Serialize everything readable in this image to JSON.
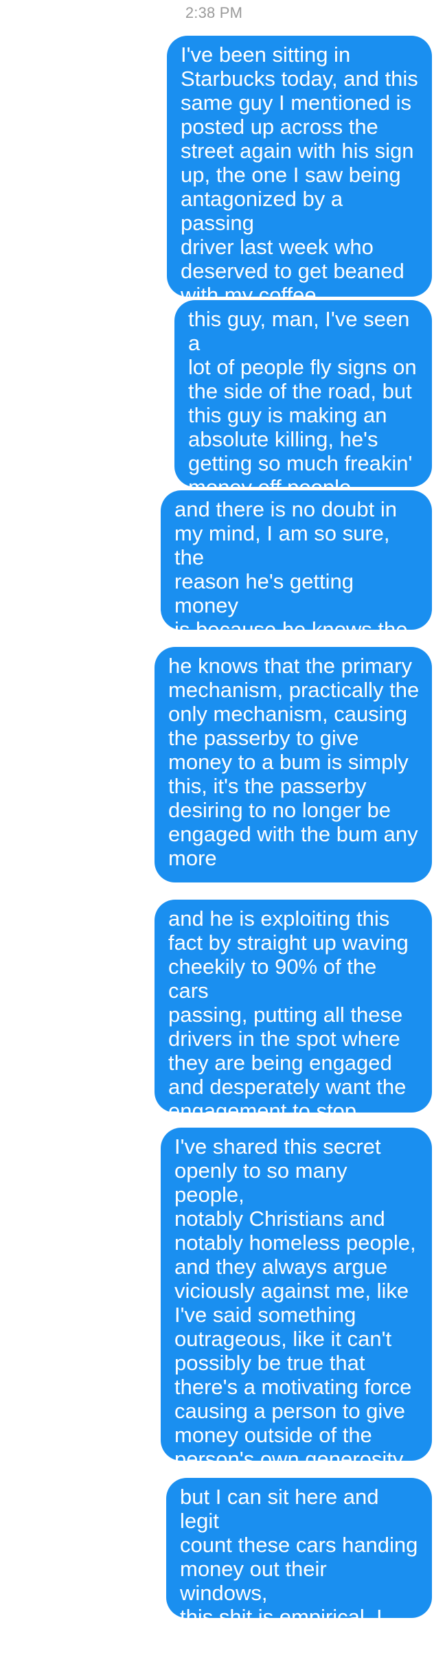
{
  "conversation": {
    "timestamp": "2:38 PM",
    "messages": [
      {
        "sender": "me",
        "text": "I've been sitting in\nStarbucks today, and this\nsame guy I mentioned is\nposted up across the\nstreet again with his sign\nup, the one I saw being\nantagonized by a passing\ndriver last week who\ndeserved to get beaned\nwith my coffee"
      },
      {
        "sender": "me",
        "text": "this guy, man, I've seen a\nlot of people fly signs on\nthe side of the road, but\nthis guy is making an\nabsolute killing, he's\ngetting so much freakin'\nmoney off people"
      },
      {
        "sender": "me",
        "text": "and there is no doubt in\nmy mind, I am so sure, the\nreason he's getting money\nis because he knows the\ntrick, he knows the secret"
      },
      {
        "sender": "me",
        "text": "he knows that the primary\nmechanism, practically the\nonly mechanism, causing\nthe passerby to give\nmoney to a bum is simply\nthis, it's the passerby\ndesiring to no longer be\nengaged with the bum any\nmore"
      },
      {
        "sender": "me",
        "text": "and he is exploiting this\nfact by straight up waving\ncheekily to 90% of the cars\npassing, putting all these\ndrivers in the spot where\nthey are being engaged\nand desperately want the\nengagement to stop"
      },
      {
        "sender": "me",
        "text": "I've shared this secret\nopenly to so many people,\nnotably Christians and\nnotably homeless people,\nand they always argue\nviciously against me, like\nI've said something\noutrageous, like it can't\npossibly be true that\nthere's a motivating force\ncausing a person to give\nmoney outside of the\nperson's own generosity"
      },
      {
        "sender": "me",
        "text": "but I can sit here and legit\ncount these cars handing\nmoney out their windows,\nthis shit is empirical, I\nhave the numbers"
      }
    ]
  },
  "colors": {
    "bubble_background": "#1a8ff0",
    "bubble_text": "#ffffff",
    "timestamp_text": "#9a9a9a"
  }
}
